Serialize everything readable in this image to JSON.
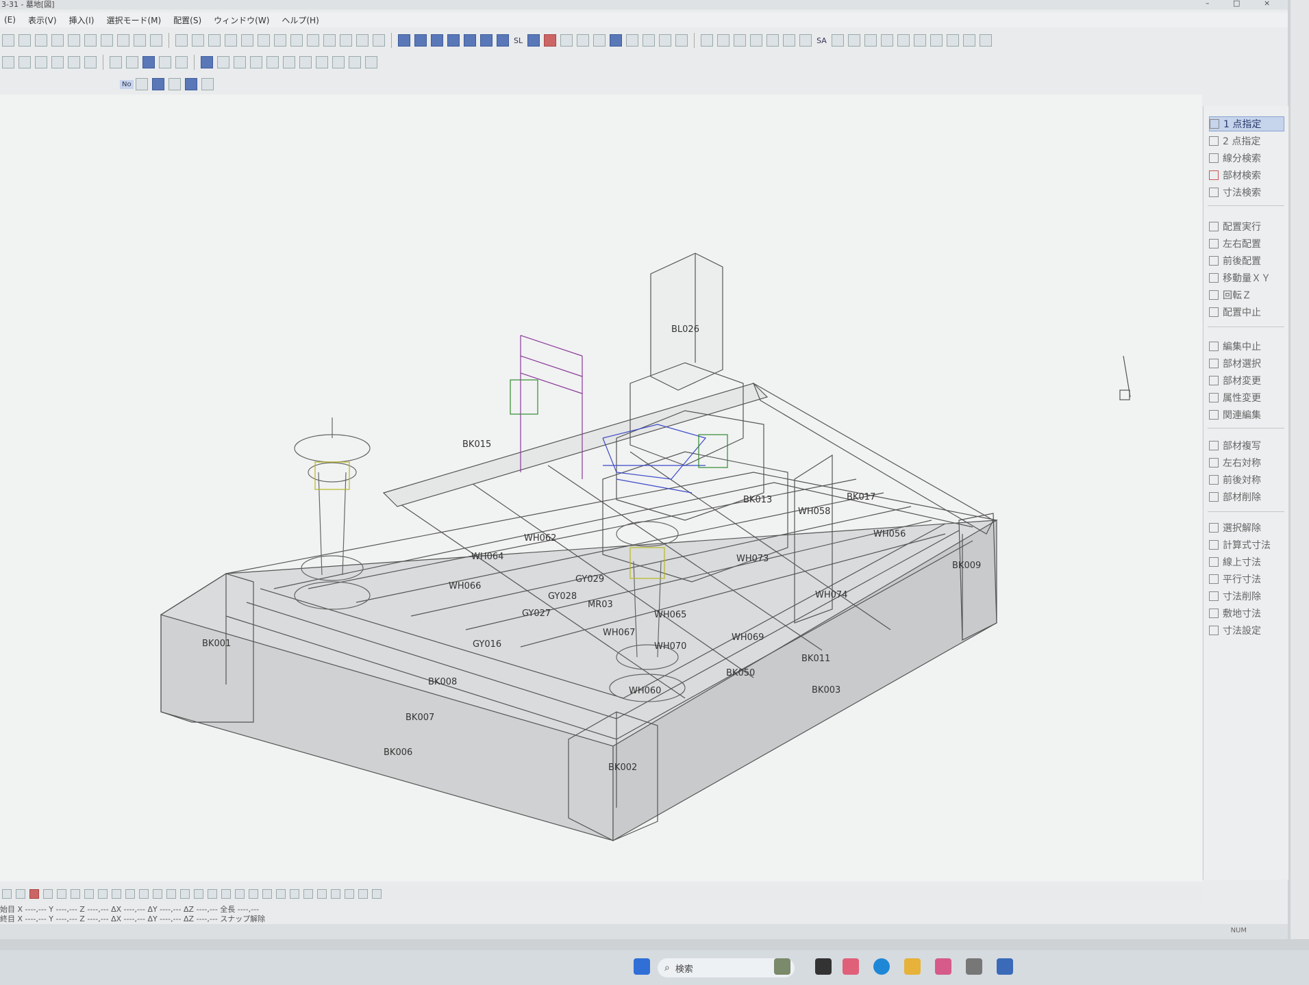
{
  "window": {
    "title": "3-31 - 墓地[図]",
    "controls": [
      "–",
      "□",
      "×"
    ]
  },
  "menu": [
    "(E)",
    "表示(V)",
    "挿入(I)",
    "選択モード(M)",
    "配置(S)",
    "ウィンドウ(W)",
    "ヘルプ(H)"
  ],
  "toolbar_text": {
    "sl": "SL",
    "sa": "SA",
    "no": "No"
  },
  "right_panel": {
    "group1": [
      "1 点指定",
      "2 点指定",
      "線分検索",
      "部材検索",
      "寸法検索"
    ],
    "group2": [
      "配置実行",
      "左右配置",
      "前後配置",
      "移動量ＸＹ",
      "回転Ｚ",
      "配置中止"
    ],
    "group3": [
      "編集中止",
      "部材選択",
      "部材変更",
      "属性変更",
      "関連編集"
    ],
    "group4": [
      "部材複写",
      "左右対称",
      "前後対称",
      "部材削除"
    ],
    "group5": [
      "選択解除",
      "計算式寸法",
      "線上寸法",
      "平行寸法",
      "寸法削除",
      "敷地寸法",
      "寸法設定"
    ]
  },
  "parts": {
    "bl026": "BL026",
    "bk001": "BK001",
    "bk002": "BK002",
    "bk003": "BK003",
    "bk006": "BK006",
    "bk007": "BK007",
    "bk008": "BK008",
    "bk009": "BK009",
    "bk011": "BK011",
    "bk013": "BK013",
    "bk015": "BK015",
    "bk017": "BK017",
    "bk050": "BK050",
    "gy016": "GY016",
    "gy027": "GY027",
    "gy028": "GY028",
    "gy029": "GY029",
    "wh056": "WH056",
    "wh058": "WH058",
    "wh060": "WH060",
    "wh062": "WH062",
    "wh064": "WH064",
    "wh065": "WH065",
    "wh066": "WH066",
    "wh067": "WH067",
    "wh069": "WH069",
    "wh070": "WH070",
    "wh073": "WH073",
    "wh074": "WH074",
    "mr03": "MR03"
  },
  "coords": {
    "row1": "始目 X ----,--- Y ----,--- Z ----,--- ΔX ----,--- ΔY ----,--- ΔZ ----,--- 全長 ----,---",
    "row2": "終目 X ----,--- Y ----,--- Z ----,--- ΔX ----,--- ΔY ----,--- ΔZ ----,--- スナップ解除"
  },
  "status": {
    "num": "NUM"
  },
  "taskbar": {
    "search_placeholder": "検索"
  },
  "colors": {
    "accent_blue": "#5a78b8",
    "panel_active": "#c6d4ec",
    "wire": "#555555",
    "purple": "#8a3a9a",
    "green": "#2e8b2e",
    "yellow": "#b8b820"
  }
}
